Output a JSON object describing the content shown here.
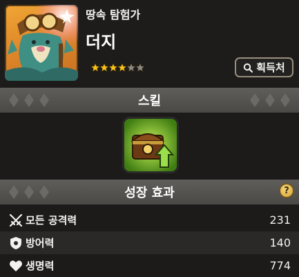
{
  "character": {
    "title": "땅속 탐험가",
    "name": "더지",
    "stars_filled": 4,
    "stars_total": 6,
    "portrait_icon": "character-portrait"
  },
  "acquire_button": {
    "label": "획득처",
    "icon": "search-icon"
  },
  "skill_section": {
    "header": "스킬",
    "skill_icon": "treasure-chest-upgrade-icon"
  },
  "growth_section": {
    "header": "성장 효과",
    "help_label": "?",
    "stats": [
      {
        "label": "모든 공격력",
        "value": "231",
        "icon": "crossed-swords-icon"
      },
      {
        "label": "방어력",
        "value": "140",
        "icon": "shield-icon"
      },
      {
        "label": "생명력",
        "value": "774",
        "icon": "heart-icon"
      }
    ]
  },
  "colors": {
    "star_gold": "#f7c21a",
    "star_empty": "#8a8a8a",
    "accent_green": "#7ad636",
    "bar_gray": "#55524f"
  }
}
